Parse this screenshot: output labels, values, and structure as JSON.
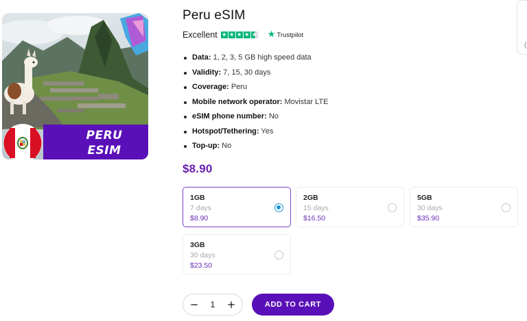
{
  "product": {
    "title": "Peru eSIM",
    "image_badge_line1": "PERU",
    "image_badge_line2": "ESIM",
    "rating_label": "Excellent",
    "rating_stars": 4.5,
    "rating_source": "Trustpilot",
    "features": [
      {
        "label": "Data:",
        "value": " 1, 2, 3, 5 GB high speed data"
      },
      {
        "label": "Validity:",
        "value": " 7, 15, 30 days"
      },
      {
        "label": "Coverage:",
        "value": " Peru"
      },
      {
        "label": "Mobile network operator:",
        "value": " Movistar LTE"
      },
      {
        "label": "eSIM phone number:",
        "value": " No"
      },
      {
        "label": "Hotspot/Tethering:",
        "value": " Yes"
      },
      {
        "label": "Top-up:",
        "value": " No"
      }
    ],
    "price": "$8.90"
  },
  "plans": [
    {
      "name": "1GB",
      "days": "7 days",
      "price": "$8.90",
      "selected": true
    },
    {
      "name": "2GB",
      "days": "15 days",
      "price": "$16.50",
      "selected": false
    },
    {
      "name": "5GB",
      "days": "30 days",
      "price": "$35.90",
      "selected": false
    },
    {
      "name": "3GB",
      "days": "30 days",
      "price": "$23.50",
      "selected": false
    }
  ],
  "cart": {
    "quantity": "1",
    "minus_label": "−",
    "plus_label": "+",
    "add_to_cart_label": "ADD TO CART"
  },
  "colors": {
    "accent": "#5a10b8",
    "price": "#6a1fb0",
    "trustpilot": "#00b67a",
    "radio_selected": "#1c95d4"
  },
  "icons": {
    "trustpilot": "trustpilot-star-icon",
    "flag": "peru-flag-icon"
  }
}
